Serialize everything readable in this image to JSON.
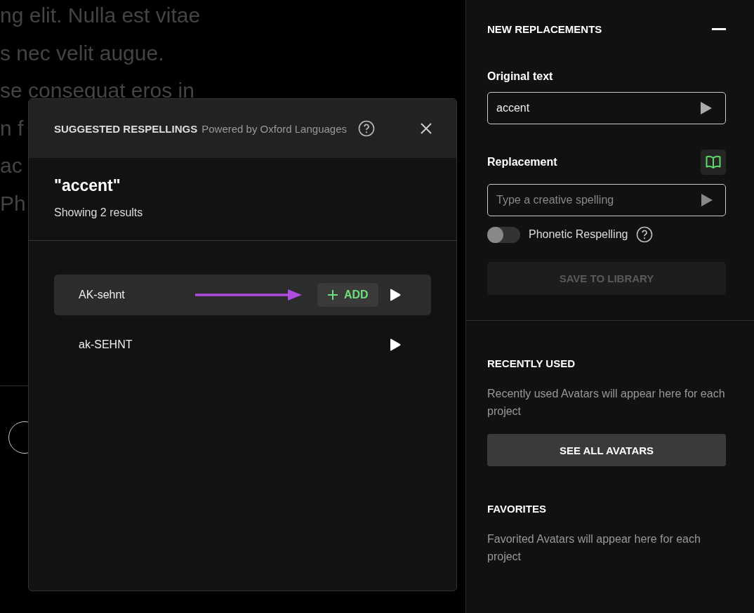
{
  "background_text": [
    "ng elit. Nulla est vitae",
    "s nec velit augue.",
    "se consequat eros in",
    "n f",
    "ac",
    "Ph"
  ],
  "dialog": {
    "title": "SUGGESTED RESPELLINGS",
    "subtitle": "Powered by Oxford Languages",
    "query": "\"accent\"",
    "result_count": "Showing 2 results",
    "add_label": "ADD",
    "results": [
      {
        "text": "AK-sehnt",
        "selected": true
      },
      {
        "text": "ak-SEHNT",
        "selected": false
      }
    ]
  },
  "panel": {
    "title": "NEW REPLACEMENTS",
    "original_text": {
      "label": "Original text",
      "value": "accent"
    },
    "replacement": {
      "label": "Replacement",
      "placeholder": "Type a creative spelling"
    },
    "phonetic_toggle": {
      "label": "Phonetic Respelling",
      "on": false
    },
    "save_button": {
      "label": "SAVE TO LIBRARY",
      "disabled": true
    },
    "recently_used": {
      "title": "RECENTLY USED",
      "description": "Recently used Avatars will appear here for each project",
      "button": "SEE ALL AVATARS"
    },
    "favorites": {
      "title": "FAVORITES",
      "description": "Favorited Avatars will appear here for each project"
    }
  }
}
